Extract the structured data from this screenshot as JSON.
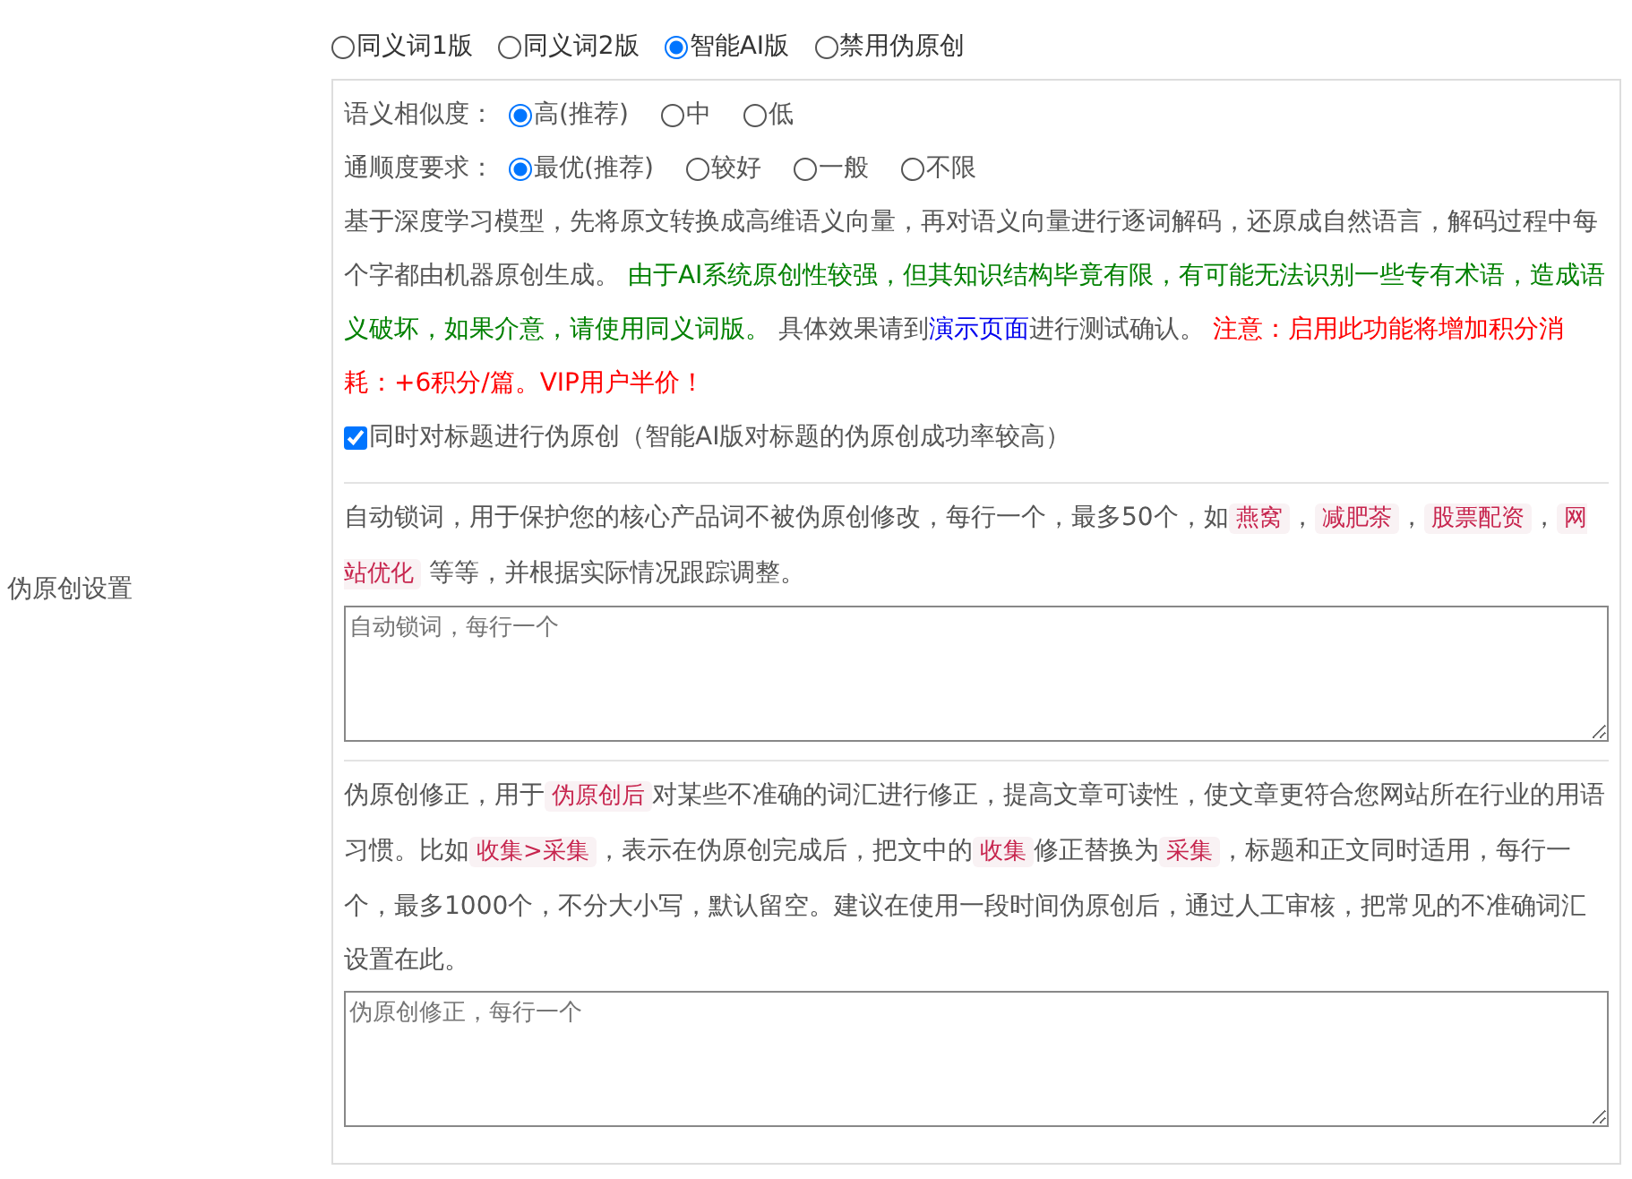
{
  "settings_label": "伪原创设置",
  "modes": [
    {
      "label": "同义词1版",
      "selected": false
    },
    {
      "label": "同义词2版",
      "selected": false
    },
    {
      "label": "智能AI版",
      "selected": true
    },
    {
      "label": "禁用伪原创",
      "selected": false
    }
  ],
  "ai_panel": {
    "similarity": {
      "label": "语义相似度：",
      "options": [
        {
          "label": "高(推荐)",
          "selected": true
        },
        {
          "label": "中",
          "selected": false
        },
        {
          "label": "低",
          "selected": false
        }
      ]
    },
    "fluency": {
      "label": "通顺度要求：",
      "options": [
        {
          "label": "最优(推荐)",
          "selected": true
        },
        {
          "label": "较好",
          "selected": false
        },
        {
          "label": "一般",
          "selected": false
        },
        {
          "label": "不限",
          "selected": false
        }
      ]
    },
    "description": [
      {
        "kind": "text",
        "text": "基于深度学习模型，先将原文转换成高维语义向量，再对语义向量进行逐词解码，还原成自然语言，解码过程中每个字都由机器原创生成。 "
      },
      {
        "kind": "warning",
        "text": "由于AI系统原创性较强，但其知识结构毕竟有限，有可能无法识别一些专有术语，造成语义破坏，如果介意，请使用同义词版。"
      },
      {
        "kind": "text",
        "text": " 具体效果请到"
      },
      {
        "kind": "link",
        "text": "演示页面"
      },
      {
        "kind": "text",
        "text": "进行测试确认。 "
      },
      {
        "kind": "alert",
        "text": "注意：启用此功能将增加积分消耗：+6积分/篇。VIP用户半价！"
      }
    ],
    "title_option": {
      "label": "同时对标题进行伪原创（智能AI版对标题的伪原创成功率较高）",
      "checked": true
    }
  },
  "lock_words": {
    "description": [
      {
        "kind": "text",
        "text": "自动锁词，用于保护您的核心产品词不被伪原创修改，每行一个，最多50个，如"
      },
      {
        "kind": "code",
        "text": "燕窝"
      },
      {
        "kind": "text",
        "text": "，"
      },
      {
        "kind": "code",
        "text": "减肥茶"
      },
      {
        "kind": "text",
        "text": "，"
      },
      {
        "kind": "code",
        "text": "股票配资"
      },
      {
        "kind": "text",
        "text": "，"
      },
      {
        "kind": "code",
        "text": "网站优化"
      },
      {
        "kind": "text",
        "text": " 等等，并根据实际情况跟踪调整。"
      }
    ],
    "placeholder": "自动锁词，每行一个"
  },
  "corrections": {
    "description": [
      {
        "kind": "text",
        "text": "伪原创修正，用于"
      },
      {
        "kind": "code",
        "text": "伪原创后"
      },
      {
        "kind": "text",
        "text": "对某些不准确的词汇进行修正，提高文章可读性，使文章更符合您网站所在行业的用语习惯。比如"
      },
      {
        "kind": "code",
        "text": "收集>采集"
      },
      {
        "kind": "text",
        "text": "，表示在伪原创完成后，把文中的"
      },
      {
        "kind": "code",
        "text": "收集"
      },
      {
        "kind": "text",
        "text": "修正替换为"
      },
      {
        "kind": "code",
        "text": "采集"
      },
      {
        "kind": "text",
        "text": "，标题和正文同时适用，每行一个，最多1000个，不分大小写，默认留空。建议在使用一段时间伪原创后，通过人工审核，把常见的不准确词汇设置在此。"
      }
    ],
    "placeholder": "伪原创修正，每行一个"
  }
}
